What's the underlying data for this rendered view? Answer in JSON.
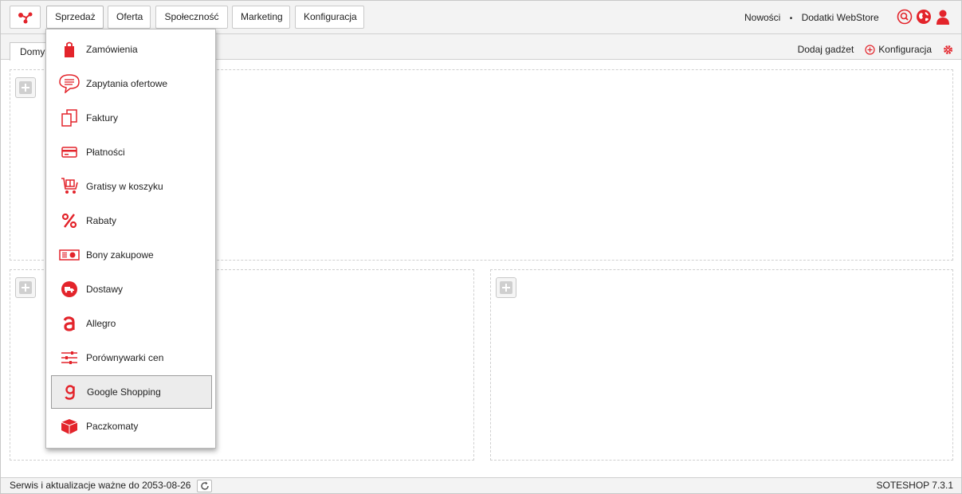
{
  "topbar": {
    "nav": [
      {
        "label": "Sprzedaż",
        "active": true
      },
      {
        "label": "Oferta"
      },
      {
        "label": "Społeczność"
      },
      {
        "label": "Marketing"
      },
      {
        "label": "Konfiguracja"
      }
    ],
    "links": {
      "news": "Nowości",
      "sep": "•",
      "webstore": "Dodatki WebStore"
    },
    "icons": [
      "search-icon",
      "globe-icon",
      "user-icon"
    ]
  },
  "tabs": [
    {
      "label": "Domyślny"
    }
  ],
  "actions": {
    "add_gadget": "Dodaj gadżet",
    "config": "Konfiguracja"
  },
  "menu": {
    "items": [
      {
        "label": "Zamówienia",
        "icon": "shopping-bag-icon"
      },
      {
        "label": "Zapytania ofertowe",
        "icon": "chat-bubble-icon"
      },
      {
        "label": "Faktury",
        "icon": "documents-icon"
      },
      {
        "label": "Płatności",
        "icon": "credit-card-icon"
      },
      {
        "label": "Gratisy w koszyku",
        "icon": "gift-cart-icon"
      },
      {
        "label": "Rabaty",
        "icon": "percent-icon"
      },
      {
        "label": "Bony zakupowe",
        "icon": "voucher-icon"
      },
      {
        "label": "Dostawy",
        "icon": "delivery-globe-icon"
      },
      {
        "label": "Allegro",
        "icon": "allegro-icon"
      },
      {
        "label": "Porównywarki cen",
        "icon": "sliders-icon"
      },
      {
        "label": "Google Shopping",
        "icon": "google-shopping-icon",
        "highlighted": true
      },
      {
        "label": "Paczkomaty",
        "icon": "parcel-locker-icon"
      }
    ]
  },
  "footer": {
    "service": "Serwis i aktualizacje ważne do 2053-08-26",
    "version": "SOTESHOP 7.3.1"
  },
  "colors": {
    "accent": "#e3242b",
    "bar": "#f3f3f3",
    "border": "#c9c9c9"
  }
}
